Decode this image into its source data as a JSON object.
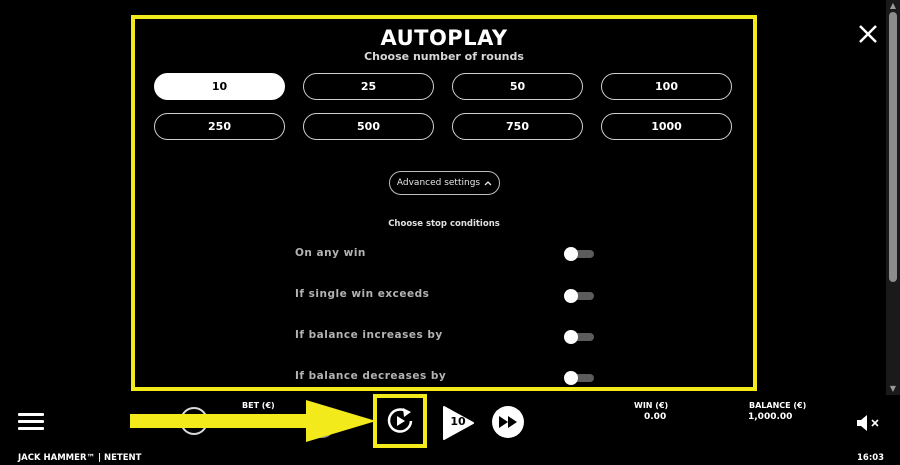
{
  "autoplay": {
    "title": "AUTOPLAY",
    "subtitle": "Choose number of rounds",
    "rounds": [
      {
        "label": "10",
        "selected": true
      },
      {
        "label": "25",
        "selected": false
      },
      {
        "label": "50",
        "selected": false
      },
      {
        "label": "100",
        "selected": false
      },
      {
        "label": "250",
        "selected": false
      },
      {
        "label": "500",
        "selected": false
      },
      {
        "label": "750",
        "selected": false
      },
      {
        "label": "1000",
        "selected": false
      }
    ],
    "advanced_label": "Advanced settings",
    "stop_title": "Choose stop conditions",
    "stop_conditions": [
      {
        "label": "On any win",
        "on": false
      },
      {
        "label": "If single win exceeds",
        "on": false
      },
      {
        "label": "If balance increases by",
        "on": false
      },
      {
        "label": "If balance decreases by",
        "on": false
      }
    ]
  },
  "bottom_bar": {
    "bet_label": "BET (€)",
    "win_label": "WIN (€)",
    "win_value": "0.00",
    "balance_label": "BALANCE (€)",
    "balance_value": "1,000.00",
    "spin_count": "10",
    "game_name": "JACK HAMMER™  |  NETENT",
    "time": "16:03"
  },
  "colors": {
    "highlight": "#f2ea1b",
    "background": "#000000",
    "toggle_track": "#5c5c5c"
  },
  "icons": [
    "close-icon",
    "chevron-up-icon",
    "menu-icon",
    "minus-icon",
    "plus-icon",
    "arrow-right-icon",
    "autoplay-icon",
    "spin-icon",
    "fast-forward-icon",
    "speaker-muted-icon"
  ]
}
